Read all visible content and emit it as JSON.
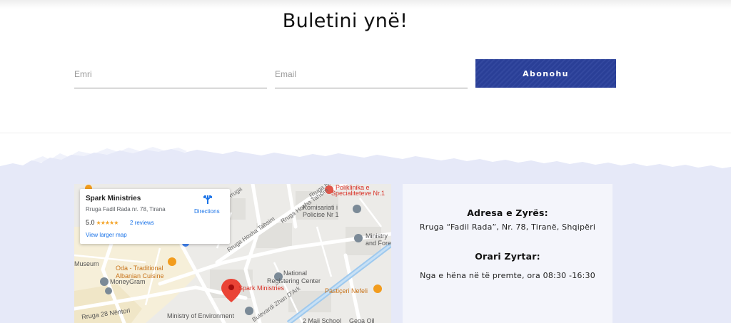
{
  "newsletter": {
    "title": "Buletini ynë!",
    "name_placeholder": "Emri",
    "email_placeholder": "Email",
    "subscribe_label": "Abonohu"
  },
  "map": {
    "place_name": "Spark Ministries",
    "address": "Rruga Fadil Rada nr. 78, Tirana",
    "rating": "5.0",
    "stars": "★★★★★",
    "reviews": "2 reviews",
    "larger_map": "View larger map",
    "directions": "Directions",
    "labels": {
      "oda": "Oda - Traditional",
      "oda2": "Albanian Cuisine",
      "museum": "Museum",
      "moneygram": "MoneyGram",
      "rruga28": "Rruga 28 Nëntori",
      "ministry_env": "Ministry of Environment",
      "national": "National",
      "registering": "Registering Center",
      "spark": "Spark Ministries",
      "pasticeri": "Pastiçeri Nefeli",
      "komisariati": "Komisariati i",
      "policise": "Policise Nr 1",
      "ministry": "Ministry",
      "andfore": "and Fore",
      "poliklinika": "Poliklinika e",
      "specialiteteve": "Specialiteteve Nr.1",
      "hoxha1": "Rruga Hoxha Tahsim",
      "hoxha2": "Rruga Hoxha Tahsim",
      "hoxha3": "Rruga Hoxha Tahsim",
      "zhan": "Bulevardi Zhan D'Ark",
      "school": "2 Maji School",
      "gega": "Gega Oil",
      "rruga_top": "Rruga"
    }
  },
  "office": {
    "address_heading": "Adresa e Zyrës:",
    "address_text": "Rruga “Fadil Rada”, Nr. 78, Tiranë, Shqipëri",
    "hours_heading": "Orari Zyrtar:",
    "hours_text": "Nga e hëna në të premte, ora 08:30 -16:30"
  },
  "colors": {
    "button": "#2a3f97",
    "lower_band": "#e6e9f8",
    "info_panel": "#f4f5fb"
  }
}
